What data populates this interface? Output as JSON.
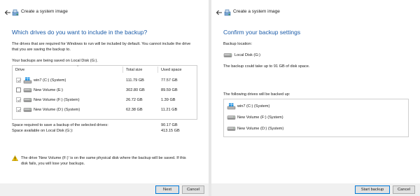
{
  "left": {
    "title": "Create a system image",
    "heading": "Which drives do you want to include in the backup?",
    "intro_line1": "The drives that are required for Windows to run will be included by default. You cannot include the drive",
    "intro_line2": "that you are saving the backup to.",
    "saving_note": "Your backups are being saved on Local Disk (G:).",
    "table": {
      "headers": {
        "drive": "Drive",
        "total": "Total size",
        "used": "Used space"
      },
      "rows": [
        {
          "name": "win7 (C:) (System)",
          "total": "111.79 GB",
          "used": "77.57 GB",
          "checked": true,
          "enabled": false,
          "icon": "windows-drive-icon"
        },
        {
          "name": "New Volume (E:)",
          "total": "302.80 GB",
          "used": "89.59 GB",
          "checked": false,
          "enabled": true,
          "icon": "drive-icon"
        },
        {
          "name": "New Volume (F:) (System)",
          "total": "26.72 GB",
          "used": "1.39 GB",
          "checked": true,
          "enabled": false,
          "icon": "drive-icon"
        },
        {
          "name": "New Volume (D:) (System)",
          "total": "62.38 GB",
          "used": "11.21 GB",
          "checked": true,
          "enabled": false,
          "icon": "drive-icon"
        }
      ]
    },
    "space_required_label": "Space required to save a backup of the selected drives:",
    "space_required_value": "90.17 GB",
    "space_available_label": "Space available on Local Disk (G:):",
    "space_available_value": "413.15 GB",
    "warning_line1": "The drive 'New Volume (F:)' is on the same physical disk where the backup will be saved. If this",
    "warning_line2": "disk fails, you will lose your backups.",
    "next_label": "Next",
    "cancel_label": "Cancel"
  },
  "right": {
    "title": "Create a system image",
    "heading": "Confirm your backup settings",
    "location_label": "Backup location:",
    "location_value": "Local Disk (G:)",
    "size_note": "The backup could take up to 91 GB of disk space.",
    "drives_label": "The following drives will be backed up:",
    "drives": [
      {
        "name": "win7 (C:) (System)",
        "icon": "windows-drive-icon"
      },
      {
        "name": "New Volume (F:) (System)",
        "icon": "drive-icon"
      },
      {
        "name": "New Volume (D:) (System)",
        "icon": "drive-icon"
      }
    ],
    "start_label": "Start backup",
    "cancel_label": "Cancel"
  },
  "colors": {
    "heading": "#1a5ba8",
    "accent": "#0078d7",
    "windows_logo": "#1e90e0",
    "warning": "#f2c200"
  }
}
